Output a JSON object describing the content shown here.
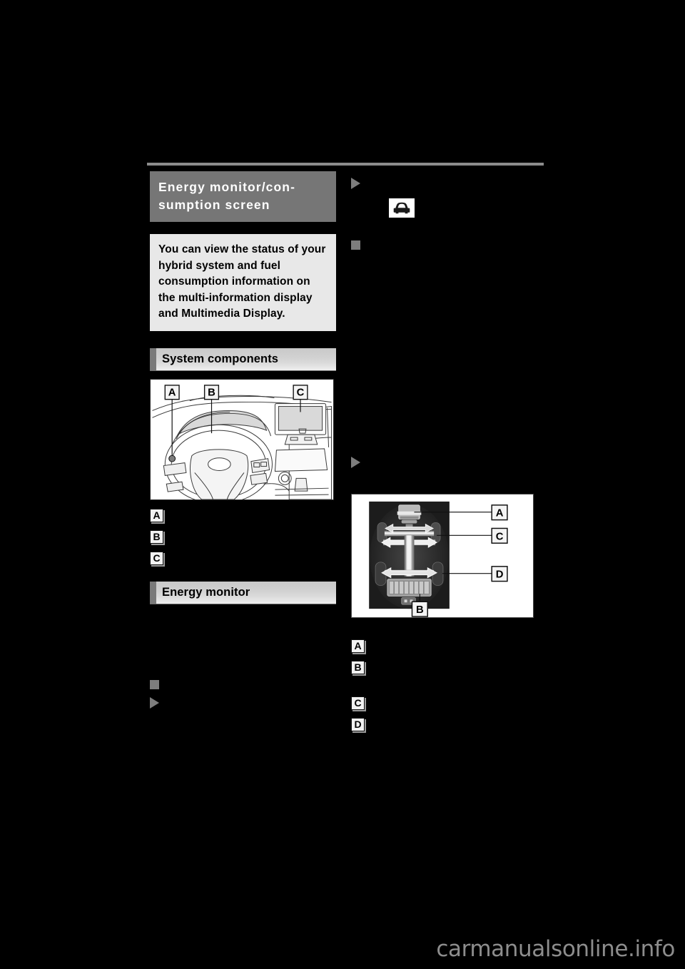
{
  "page": {
    "background_color": "#000000",
    "watermark": "carmanualsonline.info"
  },
  "left_column": {
    "chapter_title": "Energy monitor/con-\nsumption screen",
    "intro_text": "You can view the status of your hybrid system and fuel consumption information on the multi-information display and Multimedia Display.",
    "section_system_components": {
      "heading": "System components",
      "figure": {
        "name": "dashboard-illustration",
        "callouts": [
          "A",
          "B",
          "C"
        ]
      },
      "callout_list": [
        {
          "marker": "A",
          "text": ""
        },
        {
          "marker": "B",
          "text": ""
        },
        {
          "marker": "C",
          "text": ""
        }
      ]
    },
    "section_energy_monitor": {
      "heading": "Energy monitor"
    },
    "bullets": [
      {
        "type": "square",
        "text": ""
      },
      {
        "type": "triangle",
        "text": ""
      }
    ]
  },
  "right_column": {
    "bullets_top": [
      {
        "type": "triangle",
        "text": ""
      }
    ],
    "inline_icon": {
      "name": "car-front-icon",
      "label": ""
    },
    "bullets_mid": [
      {
        "type": "square",
        "text": ""
      }
    ],
    "bullets_lower": [
      {
        "type": "triangle",
        "text": ""
      }
    ],
    "figure": {
      "name": "energy-monitor-screen",
      "callouts": [
        "A",
        "C",
        "D",
        "B"
      ],
      "screen_elements": {
        "engine": "A",
        "hybrid_battery": "B",
        "front_motor_energy_flow": "C",
        "rear_motor": "D"
      }
    },
    "callout_list": [
      {
        "marker": "A",
        "text": ""
      },
      {
        "marker": "B",
        "text": ""
      },
      {
        "marker": "C",
        "text": ""
      },
      {
        "marker": "D",
        "text": ""
      }
    ]
  },
  "colors": {
    "title_box": "#767676",
    "intro_box": "#e8e8e8",
    "bar_accent": "#7a7a7a",
    "bullet": "#7d7d7d",
    "rule": "#8c8c8c",
    "watermark": "#8d8d8d"
  }
}
